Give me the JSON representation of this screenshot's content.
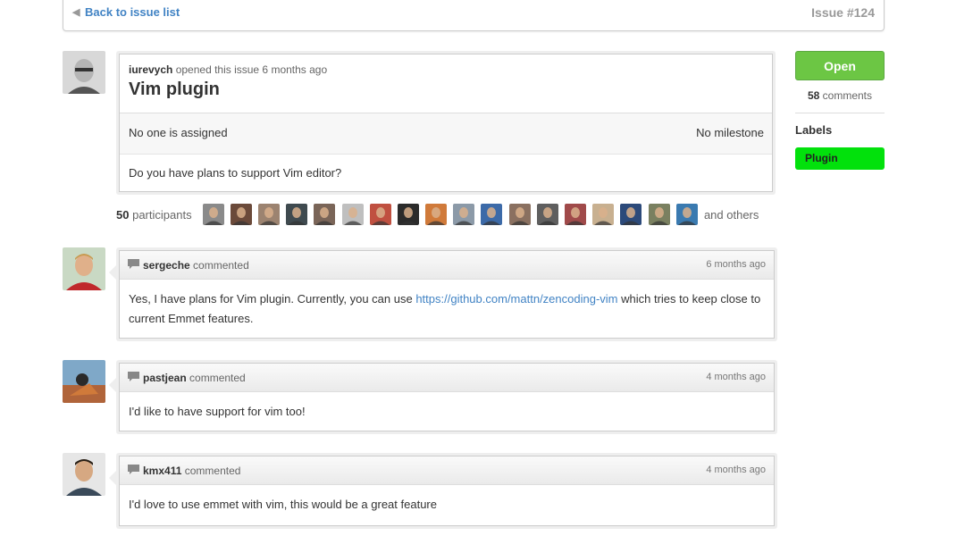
{
  "header": {
    "back_link": "Back to issue list",
    "issue_number": "Issue #124"
  },
  "issue": {
    "author": "iurevych",
    "opened_text": "opened this issue 6 months ago",
    "title": "Vim plugin",
    "assignee_text": "No one is assigned",
    "milestone_text": "No milestone",
    "body": "Do you have plans to support Vim editor?"
  },
  "participants": {
    "count": "50",
    "label": "participants",
    "others": "and others",
    "avatar_colors": [
      "#8a8a8a",
      "#6b4a3a",
      "#9c8370",
      "#3f4a4f",
      "#7a6558",
      "#bfbfbf",
      "#c05040",
      "#2b2b2b",
      "#d07a3a",
      "#8c9aa8",
      "#3c6aa8",
      "#8a7060",
      "#5f5f5f",
      "#a04a4a",
      "#c8b090",
      "#2c4a7a",
      "#7a8060",
      "#3a7ab0"
    ]
  },
  "comments": [
    {
      "author": "sergeche",
      "action": "commented",
      "time": "6 months ago",
      "body_before": "Yes, I have plans for Vim plugin. Currently, you can use ",
      "link": "https://github.com/mattn/zencoding-vim",
      "body_after": " which tries to keep close to current Emmet features."
    },
    {
      "author": "pastjean",
      "action": "commented",
      "time": "4 months ago",
      "body": "I'd like to have support for vim too!"
    },
    {
      "author": "kmx411",
      "action": "commented",
      "time": "4 months ago",
      "body": "I'd love to use emmet with vim, this would be a great feature"
    }
  ],
  "sidebar": {
    "state": "Open",
    "comments_count": "58",
    "comments_label": "comments",
    "labels_heading": "Labels",
    "labels": [
      {
        "name": "Plugin",
        "color": "#02e10c"
      }
    ]
  }
}
